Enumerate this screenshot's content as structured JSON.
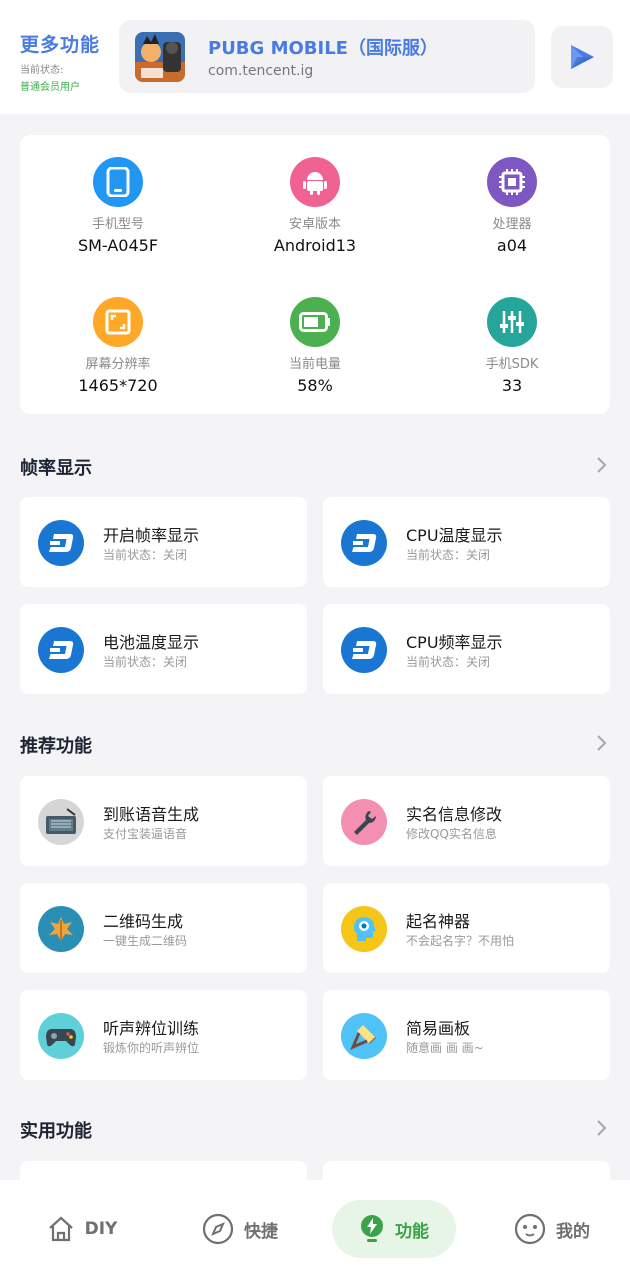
{
  "header": {
    "title": "更多功能",
    "status_label": "当前状态:",
    "status_value": "普通会员用户",
    "app": {
      "name": "PUBG MOBILE（国际服）",
      "package": "com.tencent.ig"
    }
  },
  "device_info": [
    {
      "label": "手机型号",
      "value": "SM-A045F",
      "color": "#2196f3",
      "icon": "phone-icon"
    },
    {
      "label": "安卓版本",
      "value": "Android13",
      "color": "#f06292",
      "icon": "android-icon"
    },
    {
      "label": "处理器",
      "value": "a04",
      "color": "#7e57c2",
      "icon": "cpu-icon"
    },
    {
      "label": "屏幕分辨率",
      "value": "1465*720",
      "color": "#ffa726",
      "icon": "screen-icon"
    },
    {
      "label": "当前电量",
      "value": "58%",
      "color": "#4caf50",
      "icon": "battery-icon"
    },
    {
      "label": "手机SDK",
      "value": "33",
      "color": "#26a69a",
      "icon": "sliders-icon"
    }
  ],
  "sections": {
    "fps": {
      "title": "帧率显示",
      "items": [
        {
          "title": "开启帧率显示",
          "subtitle": "当前状态：关闭"
        },
        {
          "title": "CPU温度显示",
          "subtitle": "当前状态：关闭"
        },
        {
          "title": "电池温度显示",
          "subtitle": "当前状态：关闭"
        },
        {
          "title": "CPU频率显示",
          "subtitle": "当前状态：关闭"
        }
      ]
    },
    "recommended": {
      "title": "推荐功能",
      "items": [
        {
          "title": "到账语音生成",
          "subtitle": "支付宝装逼语音",
          "icon": "radio-icon"
        },
        {
          "title": "实名信息修改",
          "subtitle": "修改QQ实名信息",
          "icon": "wrench-icon"
        },
        {
          "title": "二维码生成",
          "subtitle": "一键生成二维码",
          "icon": "leaf-icon"
        },
        {
          "title": "起名神器",
          "subtitle": "不会起名字？不用怕",
          "icon": "head-icon"
        },
        {
          "title": "听声辨位训练",
          "subtitle": "锻炼你的听声辨位",
          "icon": "gamepad-icon"
        },
        {
          "title": "简易画板",
          "subtitle": "随意画 画 画~",
          "icon": "brush-icon"
        }
      ]
    },
    "utility": {
      "title": "实用功能"
    }
  },
  "nav": [
    {
      "label": "DIY",
      "icon": "home-icon"
    },
    {
      "label": "快捷",
      "icon": "compass-icon"
    },
    {
      "label": "功能",
      "icon": "bolt-icon",
      "active": true
    },
    {
      "label": "我的",
      "icon": "face-icon"
    }
  ],
  "colors": {
    "accent": "#4a7be0",
    "green": "#3ca24a",
    "dash_blue": "#1976d2"
  }
}
